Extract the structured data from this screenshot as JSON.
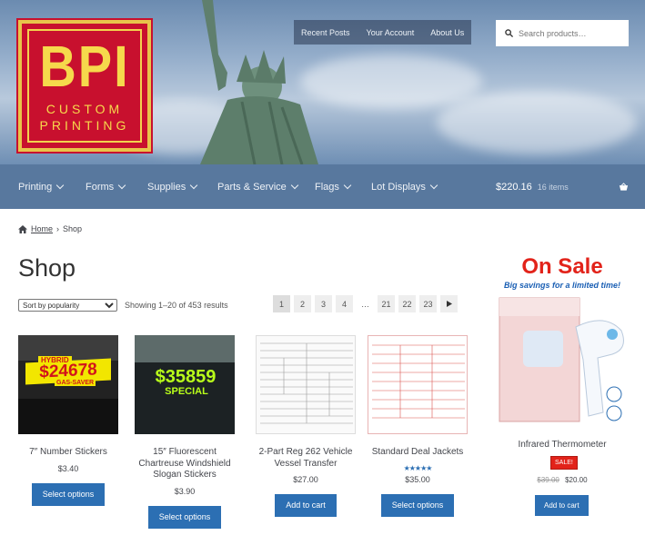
{
  "brand": {
    "logo_main": "BPI",
    "logo_line1": "CUSTOM",
    "logo_line2": "PRINTING"
  },
  "topnav": [
    "Recent Posts",
    "Your Account",
    "About Us"
  ],
  "search": {
    "placeholder": "Search products…"
  },
  "mainnav": [
    "Printing",
    "Forms",
    "Supplies",
    "Parts & Service",
    "Flags",
    "Lot Displays"
  ],
  "cart": {
    "total": "$220.16",
    "count": "16 items",
    "icon": "basket-icon"
  },
  "breadcrumb": {
    "home": "Home",
    "current": "Shop"
  },
  "page_title": "Shop",
  "sort": {
    "selected": "Sort by popularity"
  },
  "results_text": "Showing 1–20 of 453 results",
  "pagination": [
    "1",
    "2",
    "3",
    "4",
    "…",
    "21",
    "22",
    "23"
  ],
  "products": [
    {
      "name": "7″ Number Stickers",
      "price": "$3.40",
      "button": "Select options",
      "sticker_top": "HYBRID",
      "sticker_main": "$24678",
      "sticker_bottom": "GAS-SAVER"
    },
    {
      "name": "15″ Fluorescent Chartreuse Windshield Slogan Stickers",
      "price": "$3.90",
      "button": "Select options",
      "sticker_main": "$35859",
      "sticker_bottom": "SPECIAL"
    },
    {
      "name": "2-Part Reg 262 Vehicle Vessel Transfer",
      "price": "$27.00",
      "button": "Add to cart"
    },
    {
      "name": "Standard Deal Jackets",
      "price": "$35.00",
      "button": "Select options",
      "rating": 5
    }
  ],
  "sidebar": {
    "headline": "On Sale",
    "subline": "Big savings for a limited time!",
    "product_name": "Infrared Thermometer",
    "badge": "SALE!",
    "old_price": "$39.00",
    "new_price": "$20.00",
    "button": "Add to cart"
  },
  "colors": {
    "accent": "#2c6fb3",
    "nav": "#4a6c96",
    "sale": "#e2231a"
  }
}
